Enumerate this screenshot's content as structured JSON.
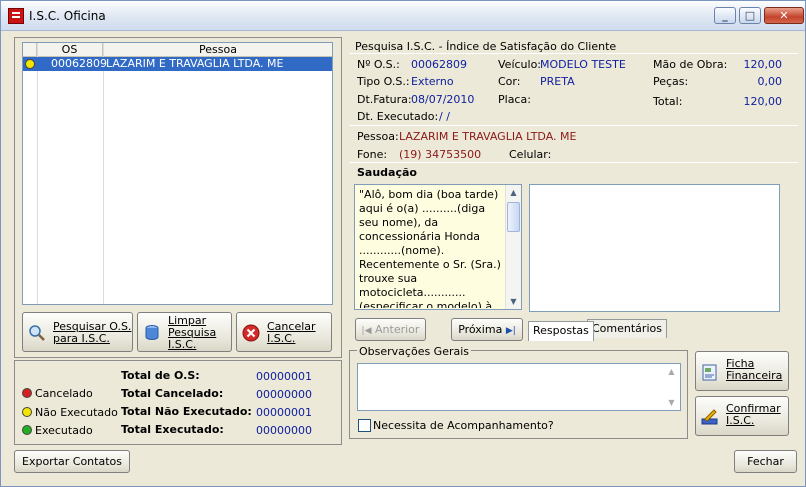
{
  "window": {
    "title": "I.S.C. Oficina",
    "min_label": "_",
    "max_label": "□",
    "close_label": "✕"
  },
  "grid": {
    "headers": [
      "OS",
      "Pessoa"
    ],
    "rows": [
      {
        "os": "00062809",
        "pessoa": "LAZARIM E TRAVAGLIA LTDA. ME",
        "status_color": "#f2e600"
      }
    ]
  },
  "left_buttons": {
    "pesquisar": "Pesquisar O.S.\npara I.S.C.",
    "limpar": "Limpar\nPesquisa\nI.S.C.",
    "cancelar": "Cancelar\nI.S.C."
  },
  "legend": {
    "items": [
      {
        "label": "Cancelado",
        "color": "#d42020"
      },
      {
        "label": "Não Executado",
        "color": "#f2e600"
      },
      {
        "label": "Executado",
        "color": "#22b022"
      }
    ],
    "totals": [
      {
        "label": "Total de O.S:",
        "value": "00000001"
      },
      {
        "label": "Total Cancelado:",
        "value": "00000000"
      },
      {
        "label": "Total Não Executado:",
        "value": "00000001"
      },
      {
        "label": "Total Executado:",
        "value": "00000000"
      }
    ]
  },
  "info": {
    "section_title": "Pesquisa I.S.C. - Índice de Satisfação do Cliente",
    "os_label": "Nº O.S.:",
    "os_value": "00062809",
    "tipo_label": "Tipo O.S.:",
    "tipo_value": "Externo",
    "fatura_label": "Dt.Fatura:",
    "fatura_value": "08/07/2010",
    "executado_label": "Dt. Executado:",
    "executado_value": "/ /",
    "veiculo_label": "Veículo:",
    "veiculo_value": "MODELO TESTE",
    "cor_label": "Cor:",
    "cor_value": "PRETA",
    "placa_label": "Placa:",
    "mao_label": "Mão de Obra:",
    "mao_value": "120,00",
    "pecas_label": "Peças:",
    "pecas_value": "0,00",
    "total_label": "Total:",
    "total_value": "120,00",
    "pessoa_label": "Pessoa:",
    "pessoa_value": "LAZARIM E TRAVAGLIA LTDA. ME",
    "fone_label": "Fone:",
    "fone_value": "(19) 34753500",
    "celular_label": "Celular:"
  },
  "saudacao": {
    "title": "Saudação",
    "text": "\"Alô, bom dia (boa tarde) aqui é o(a) ..........(diga seu nome), da concessionária Honda ............(nome). Recentemente o Sr. (Sra.) trouxe sua motocicleta............ (especificar o modelo) à nossa concessionária e eu",
    "anterior": "Anterior",
    "proxima": "Próxima",
    "tab_respostas": "Respostas",
    "tab_comentarios": "Comentários"
  },
  "observacoes": {
    "title": "Observações Gerais",
    "checkbox_label": "Necessita de Acompanhamento?",
    "ficha_label": "Ficha\nFinanceira",
    "confirmar_label": "Confirmar\nI.S.C."
  },
  "bottom": {
    "exportar": "Exportar Contatos",
    "fechar": "Fechar"
  }
}
